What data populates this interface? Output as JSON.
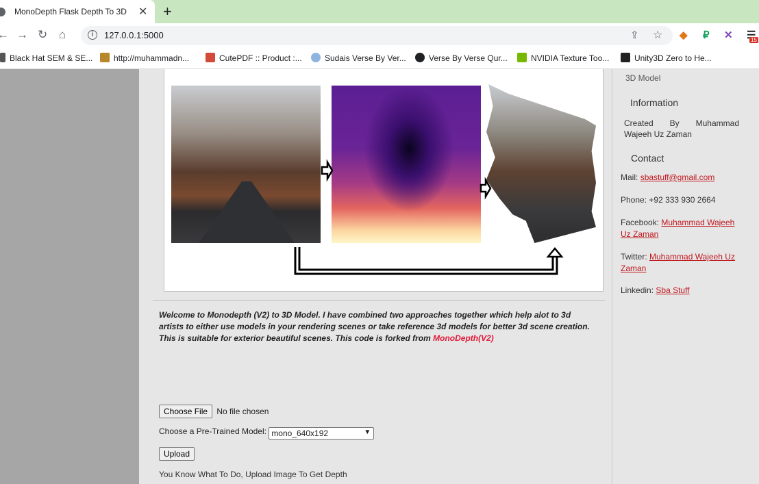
{
  "browser": {
    "tab_title": "MonoDepth Flask Depth To 3D",
    "url": "127.0.0.1:5000",
    "bookmarks": [
      {
        "label": "Black Hat SEM & SE..."
      },
      {
        "label": "http://muhammadn..."
      },
      {
        "label": "CutePDF :: Product :..."
      },
      {
        "label": "Sudais Verse By Ver..."
      },
      {
        "label": "Verse By Verse Qur..."
      },
      {
        "label": "NVIDIA Texture Too..."
      },
      {
        "label": "Unity3D Zero to He..."
      }
    ],
    "extension_badge": "15"
  },
  "main": {
    "intro_text": "Welcome to Monodepth (V2) to 3D Model. I have combined two approaches together which help alot to 3d artists to either use models in your rendering scenes or take reference 3d models for better 3d scene creation. This is suitable for exterior beautiful scenes. This code is forked from",
    "intro_link": "MonoDepth(V2)",
    "file_button": "Choose File",
    "file_status": "No file chosen",
    "model_label": "Choose a Pre-Trained Model:",
    "model_selected": "mono_640x192",
    "upload_button": "Upload",
    "hint": "You Know What To Do, Upload Image To Get Depth"
  },
  "sidebar": {
    "top_item": "3D Model",
    "information_heading": "Information",
    "created_by": "Created By Muhammad Wajeeh Uz Zaman",
    "contact_heading": "Contact",
    "mail_label": "Mail:",
    "mail_value": "sbastuff@gmail.com",
    "phone_label": "Phone:",
    "phone_value": "+92 333 930 2664",
    "facebook_label": "Facebook:",
    "facebook_value": "Muhammad Wajeeh Uz Zaman",
    "twitter_label": "Twitter:",
    "twitter_value": "Muhammad Wajeeh Uz Zaman",
    "linkedin_label": "Linkedin:",
    "linkedin_value": "Sba Stuff"
  },
  "colors": {
    "tabstrip": "#c8e6c0",
    "link_red": "#c0181f",
    "intro_link": "#e21a3a",
    "panel_bg": "#e6e6e6"
  }
}
